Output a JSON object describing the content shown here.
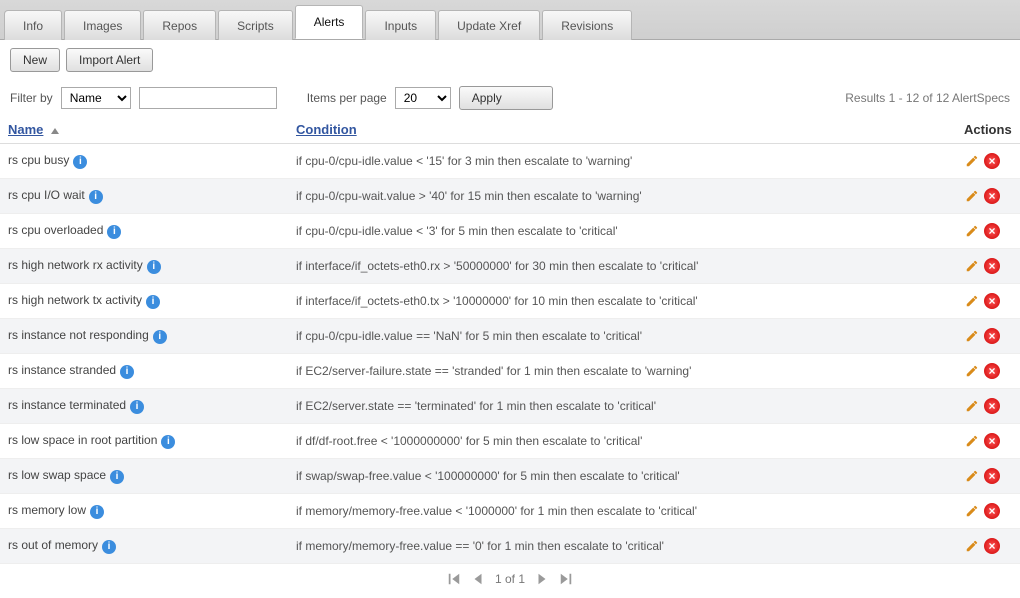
{
  "tabs": [
    "Info",
    "Images",
    "Repos",
    "Scripts",
    "Alerts",
    "Inputs",
    "Update Xref",
    "Revisions"
  ],
  "active_tab_index": 4,
  "toolbar": {
    "new_label": "New",
    "import_label": "Import Alert"
  },
  "filter": {
    "label": "Filter by",
    "field": "Name",
    "query": "",
    "ipp_label": "Items per page",
    "ipp_value": "20",
    "apply_label": "Apply"
  },
  "summary": "Results 1 - 12 of 12 AlertSpecs",
  "columns": {
    "name": "Name",
    "condition": "Condition",
    "actions": "Actions"
  },
  "rows": [
    {
      "name": "rs cpu busy",
      "condition": "if cpu-0/cpu-idle.value < '15' for 3 min then escalate to 'warning'"
    },
    {
      "name": "rs cpu I/O wait",
      "condition": "if cpu-0/cpu-wait.value > '40' for 15 min then escalate to 'warning'"
    },
    {
      "name": "rs cpu overloaded",
      "condition": "if cpu-0/cpu-idle.value < '3' for 5 min then escalate to 'critical'"
    },
    {
      "name": "rs high network rx activity",
      "condition": "if interface/if_octets-eth0.rx > '50000000' for 30 min then escalate to 'critical'"
    },
    {
      "name": "rs high network tx activity",
      "condition": "if interface/if_octets-eth0.tx > '10000000' for 10 min then escalate to 'critical'"
    },
    {
      "name": "rs instance not responding",
      "condition": "if cpu-0/cpu-idle.value == 'NaN' for 5 min then escalate to 'critical'"
    },
    {
      "name": "rs instance stranded",
      "condition": "if EC2/server-failure.state == 'stranded' for 1 min then escalate to 'warning'"
    },
    {
      "name": "rs instance terminated",
      "condition": "if EC2/server.state == 'terminated' for 1 min then escalate to 'critical'"
    },
    {
      "name": "rs low space in root partition",
      "condition": "if df/df-root.free < '1000000000' for 5 min then escalate to 'critical'"
    },
    {
      "name": "rs low swap space",
      "condition": "if swap/swap-free.value < '100000000' for 5 min then escalate to 'critical'"
    },
    {
      "name": "rs memory low",
      "condition": "if memory/memory-free.value < '1000000' for 1 min then escalate to 'critical'"
    },
    {
      "name": "rs out of memory",
      "condition": "if memory/memory-free.value == '0' for 1 min then escalate to 'critical'"
    }
  ],
  "pager": {
    "text": "1 of 1"
  }
}
